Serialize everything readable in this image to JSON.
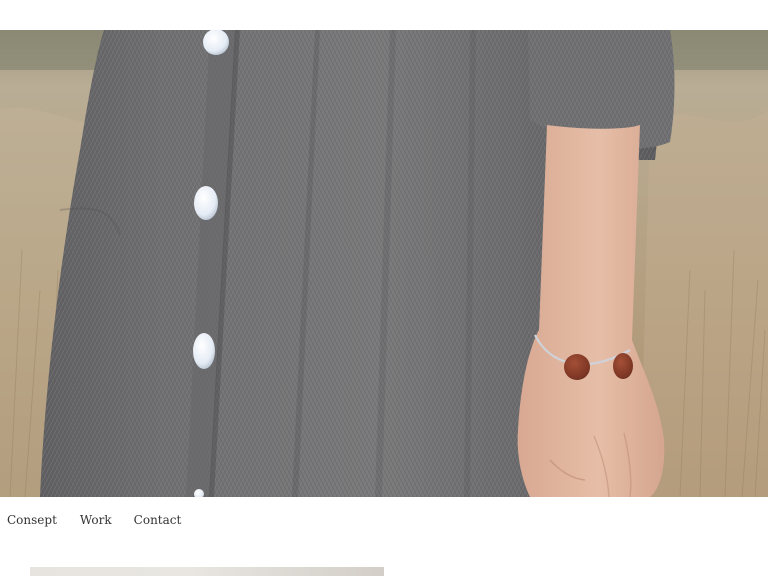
{
  "hero": {
    "colors": {
      "field": "#b5a487",
      "dress": "#6c6c6c",
      "buttons": "#e8eef7",
      "skin": "#e2b8a0",
      "bracelet": "#8b3f2b"
    }
  },
  "nav": {
    "items": [
      {
        "label": "Consept",
        "key": "consept"
      },
      {
        "label": "Work",
        "key": "work"
      },
      {
        "label": "Contact",
        "key": "contact"
      }
    ]
  }
}
